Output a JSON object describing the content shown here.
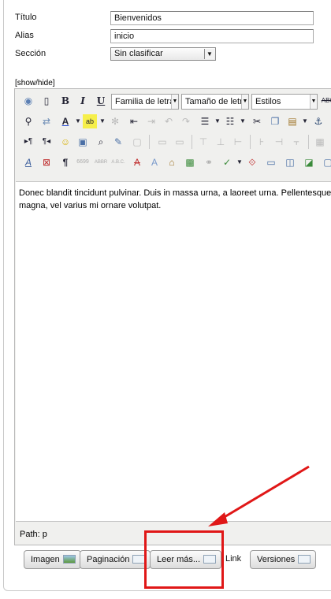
{
  "fields": {
    "titulo": {
      "label": "Título",
      "value": "Bienvenidos"
    },
    "alias": {
      "label": "Alias",
      "value": "inicio"
    },
    "seccion": {
      "label": "Sección",
      "value": "Sin clasificar"
    }
  },
  "editor": {
    "toggle": "[show/hide]",
    "font_family": "Familia de letra",
    "font_size": "Tamaño de letra",
    "styles": "Estilos",
    "content_line1": "Donec blandit tincidunt pulvinar. Duis in massa urna, a laoreet urna. Pellentesque",
    "content_line2": "magna, vel varius mi ornare volutpat.",
    "path": "Path: p"
  },
  "buttons": {
    "imagen": "Imagen",
    "paginacion": "Paginación",
    "leer_mas": "Leer más...",
    "link": "Link",
    "versiones": "Versiones"
  },
  "accent": {
    "highlight": "#e01717"
  }
}
